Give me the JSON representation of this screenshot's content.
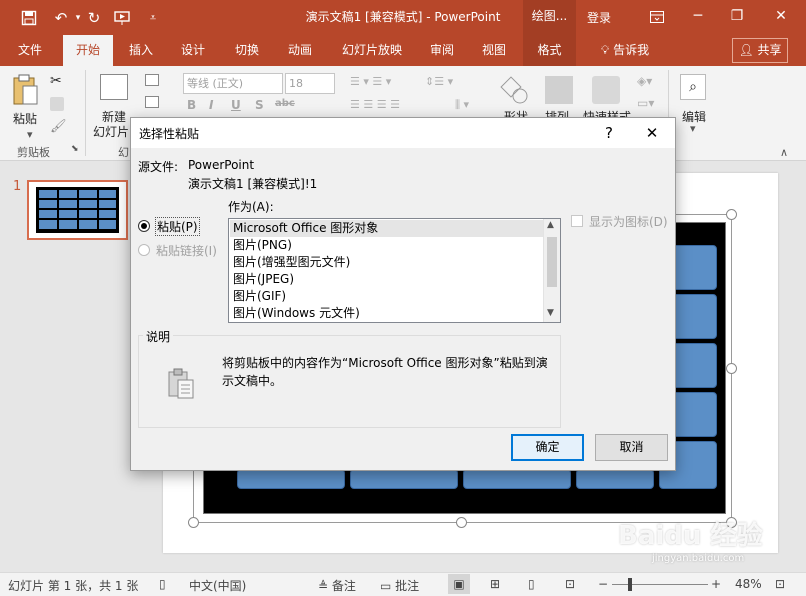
{
  "titlebar": {
    "title": "演示文稿1 [兼容模式] - PowerPoint",
    "drawing_tools": "绘图...",
    "login": "登录",
    "minimize": "─",
    "restore": "❐",
    "close": "✕",
    "bg_color": "#b7472a"
  },
  "tabs": [
    {
      "label": "文件"
    },
    {
      "label": "开始"
    },
    {
      "label": "插入"
    },
    {
      "label": "设计"
    },
    {
      "label": "切换"
    },
    {
      "label": "动画"
    },
    {
      "label": "幻灯片放映"
    },
    {
      "label": "审阅"
    },
    {
      "label": "视图"
    },
    {
      "label": "格式"
    },
    {
      "label": "告诉我"
    }
  ],
  "share": "共享",
  "ribbon": {
    "paste_label": "粘贴",
    "clipboard_group": "剪贴板",
    "new_slide_line1": "新建",
    "new_slide_line2": "幻灯片",
    "slides_group_partial": "幻",
    "font_name_placeholder": "等线 (正文)",
    "font_size_placeholder": "18",
    "shape_label": "形状",
    "arrange_label": "排列",
    "quick_styles_label": "快速样式",
    "edit_label": "编辑"
  },
  "thumbnail": {
    "number": "1"
  },
  "dialog": {
    "title": "选择性粘贴",
    "help": "?",
    "close": "✕",
    "source_label": "源文件:",
    "source_app": "PowerPoint",
    "source_doc": "演示文稿1 [兼容模式]!1",
    "as_label": "作为(A):",
    "paste_radio": "粘贴(P)",
    "paste_link_radio": "粘贴链接(I)",
    "display_icon": "显示为图标(D)",
    "list_items": [
      "Microsoft Office 图形对象",
      "图片(PNG)",
      "图片(增强型图元文件)",
      "图片(JPEG)",
      "图片(GIF)",
      "图片(Windows 元文件)"
    ],
    "description_group": "说明",
    "description_text_line1": "将剪贴板中的内容作为“Microsoft Office 图形对象”粘贴到演",
    "description_text_line2": "示文稿中。",
    "ok": "确定",
    "cancel": "取消"
  },
  "statusbar": {
    "slide_info": "幻灯片 第 1 张，共 1 张",
    "language": "中文(中国)",
    "notes": "备注",
    "comments": "批注",
    "zoom": "48%"
  },
  "watermark": {
    "text": "Baidu 经验",
    "url": "jingyan.baidu.com"
  }
}
